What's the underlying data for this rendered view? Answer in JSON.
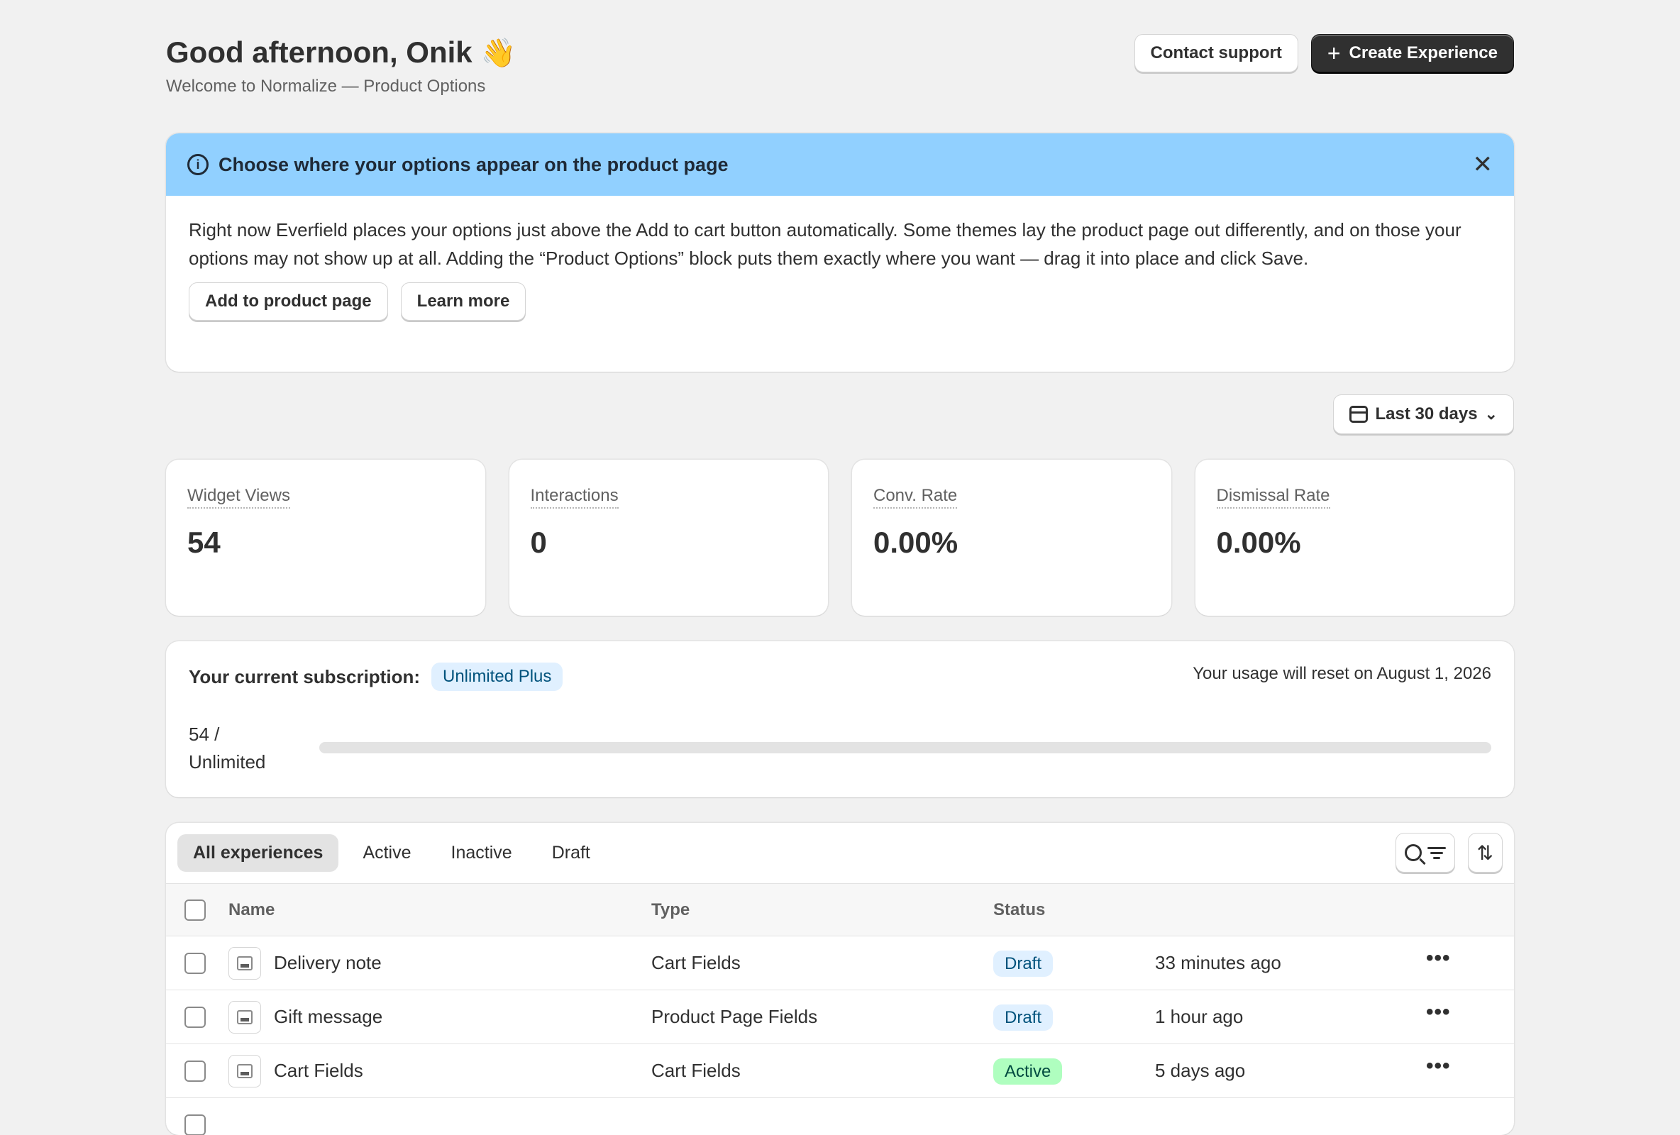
{
  "header": {
    "greeting": "Good afternoon, Onik",
    "wave_emoji": "👋",
    "subtitle": "Welcome to Normalize — Product Options",
    "contact_support_label": "Contact support",
    "create_experience_label": "Create Experience"
  },
  "banner": {
    "title": "Choose where your options appear on the product page",
    "body": "Right now Everfield places your options just above the Add to cart button automatically. Some themes lay the product page out differently, and on those your options may not show up at all. Adding the “Product Options” block puts them exactly where you want — drag it into place and click Save.",
    "primary_button": "Add to product page",
    "secondary_button": "Learn more",
    "color": "#91d0ff"
  },
  "date_range": {
    "label": "Last 30 days"
  },
  "metrics": [
    {
      "label": "Widget Views",
      "value": "54"
    },
    {
      "label": "Interactions",
      "value": "0"
    },
    {
      "label": "Conv. Rate",
      "value": "0.00%"
    },
    {
      "label": "Dismissal Rate",
      "value": "0.00%"
    }
  ],
  "subscription": {
    "label": "Your current subscription:",
    "plan": "Unlimited Plus",
    "reset_text": "Your usage will reset on August 1, 2026",
    "usage_count": "54 /",
    "usage_limit": "Unlimited",
    "progress_fraction": 0
  },
  "experiences": {
    "tabs": [
      "All experiences",
      "Active",
      "Inactive",
      "Draft"
    ],
    "selected_tab": "All experiences",
    "columns": {
      "name": "Name",
      "type": "Type",
      "status": "Status"
    },
    "rows": [
      {
        "name": "Delivery note",
        "type": "Cart Fields",
        "status": "Draft",
        "updated": "33 minutes ago"
      },
      {
        "name": "Gift message",
        "type": "Product Page Fields",
        "status": "Draft",
        "updated": "1 hour ago"
      },
      {
        "name": "Cart Fields",
        "type": "Cart Fields",
        "status": "Active",
        "updated": "5 days ago"
      }
    ],
    "more_label": "•••"
  },
  "icons": {
    "info": "info-icon",
    "close": "close-icon",
    "plus": "plus-icon",
    "calendar": "calendar-icon",
    "chevron": "chevron-down-icon",
    "search": "search-icon",
    "filter": "filter-icon",
    "sort": "sort-icon"
  }
}
